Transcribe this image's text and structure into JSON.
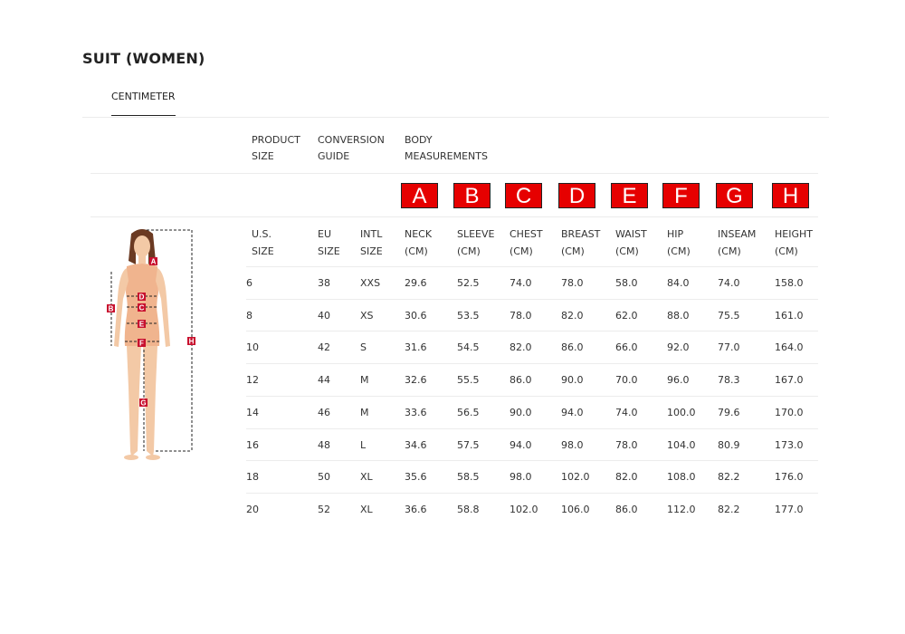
{
  "title": "SUIT (WOMEN)",
  "tabs": [
    {
      "label": "CENTIMETER",
      "active": true
    }
  ],
  "headers": {
    "product_size": [
      "PRODUCT",
      "SIZE"
    ],
    "conversion_guide": [
      "CONVERSION",
      "GUIDE"
    ],
    "body_measurements": [
      "BODY",
      "MEASUREMENTS"
    ]
  },
  "letters": [
    "A",
    "B",
    "C",
    "D",
    "E",
    "F",
    "G",
    "H"
  ],
  "columns": [
    [
      "U.S.",
      "SIZE"
    ],
    [
      "EU",
      "SIZE"
    ],
    [
      "INTL",
      "SIZE"
    ],
    [
      "NECK",
      "(CM)"
    ],
    [
      "SLEEVE",
      "(CM)"
    ],
    [
      "CHEST",
      "(CM)"
    ],
    [
      "BREAST",
      "(CM)"
    ],
    [
      "WAIST",
      "(CM)"
    ],
    [
      "HIP",
      "(CM)"
    ],
    [
      "INSEAM",
      "(CM)"
    ],
    [
      "HEIGHT",
      "(CM)"
    ]
  ],
  "rows": [
    [
      "6",
      "38",
      "XXS",
      "29.6",
      "52.5",
      "74.0",
      "78.0",
      "58.0",
      "84.0",
      "74.0",
      "158.0"
    ],
    [
      "8",
      "40",
      "XS",
      "30.6",
      "53.5",
      "78.0",
      "82.0",
      "62.0",
      "88.0",
      "75.5",
      "161.0"
    ],
    [
      "10",
      "42",
      "S",
      "31.6",
      "54.5",
      "82.0",
      "86.0",
      "66.0",
      "92.0",
      "77.0",
      "164.0"
    ],
    [
      "12",
      "44",
      "M",
      "32.6",
      "55.5",
      "86.0",
      "90.0",
      "70.0",
      "96.0",
      "78.3",
      "167.0"
    ],
    [
      "14",
      "46",
      "M",
      "33.6",
      "56.5",
      "90.0",
      "94.0",
      "74.0",
      "100.0",
      "79.6",
      "170.0"
    ],
    [
      "16",
      "48",
      "L",
      "34.6",
      "57.5",
      "94.0",
      "98.0",
      "78.0",
      "104.0",
      "80.9",
      "173.0"
    ],
    [
      "18",
      "50",
      "XL",
      "35.6",
      "58.5",
      "98.0",
      "102.0",
      "82.0",
      "108.0",
      "82.2",
      "176.0"
    ],
    [
      "20",
      "52",
      "XL",
      "36.6",
      "58.8",
      "102.0",
      "106.0",
      "86.0",
      "112.0",
      "82.2",
      "177.0"
    ]
  ],
  "figure_labels": [
    "A",
    "B",
    "C",
    "D",
    "E",
    "F",
    "G",
    "H"
  ],
  "colors": {
    "accent": "#e60000",
    "text": "#333333",
    "divider": "#ececec"
  }
}
